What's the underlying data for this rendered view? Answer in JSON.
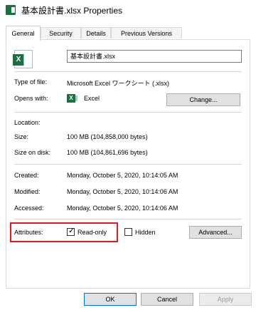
{
  "window": {
    "title": "基本設計書.xlsx Properties",
    "icon": "excel-icon"
  },
  "tabs": [
    {
      "label": "General",
      "active": true
    },
    {
      "label": "Security",
      "active": false
    },
    {
      "label": "Details",
      "active": false
    },
    {
      "label": "Previous Versions",
      "active": false
    }
  ],
  "file": {
    "name": "基本設計書.xlsx"
  },
  "props": {
    "type_label": "Type of file:",
    "type_value": "Microsoft Excel ワークシート (.xlsx)",
    "opens_label": "Opens with:",
    "opens_value": "Excel",
    "change_button": "Change...",
    "location_label": "Location:",
    "location_value": "",
    "size_label": "Size:",
    "size_value": "100 MB (104,858,000 bytes)",
    "size_disk_label": "Size on disk:",
    "size_disk_value": "100 MB (104,861,696 bytes)",
    "created_label": "Created:",
    "created_value": "Monday, October 5, 2020, 10:14:05 AM",
    "modified_label": "Modified:",
    "modified_value": "Monday, October 5, 2020, 10:14:06 AM",
    "accessed_label": "Accessed:",
    "accessed_value": "Monday, October 5, 2020, 10:14:06 AM"
  },
  "attributes": {
    "label": "Attributes:",
    "readonly_label": "Read-only",
    "readonly_checked": true,
    "hidden_label": "Hidden",
    "hidden_checked": false,
    "advanced_button": "Advanced..."
  },
  "footer": {
    "ok": "OK",
    "cancel": "Cancel",
    "apply": "Apply"
  }
}
